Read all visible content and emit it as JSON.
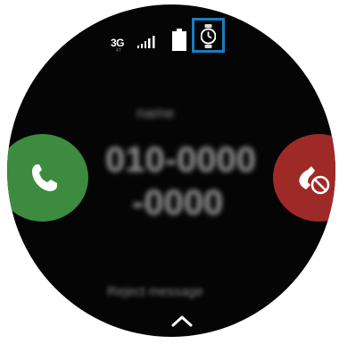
{
  "status_bar": {
    "network_type": "3G",
    "network_sub": "4T",
    "signal_icon": "signal-bars-icon",
    "battery_icon": "battery-icon",
    "watch_icon": "watch-icon",
    "highlight_color": "#1a7dbd"
  },
  "incoming_call": {
    "caller_name": "name",
    "caller_number_line1": "010-0000",
    "caller_number_line2": "-0000",
    "accept_icon": "phone-icon",
    "accept_color": "#3d8b3f",
    "decline_icon": "phone-decline-icon",
    "decline_color": "#9e2a28",
    "reject_message_label": "Reject message",
    "swipe_icon": "chevron-up-icon"
  }
}
